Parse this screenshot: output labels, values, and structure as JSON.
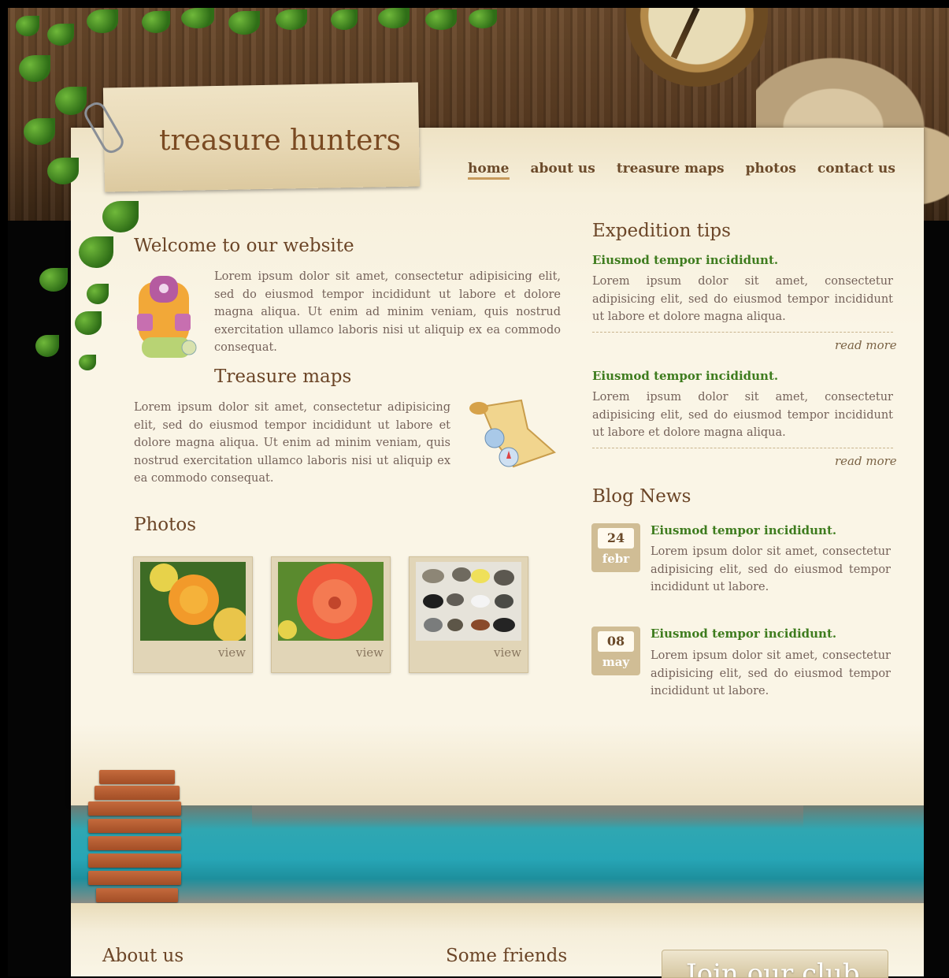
{
  "site_title": "treasure hunters",
  "nav": {
    "items": [
      "home",
      "about us",
      "treasure maps",
      "photos",
      "contact us"
    ],
    "active": "home"
  },
  "welcome": {
    "title": "Welcome to our website",
    "text": "Lorem ipsum dolor sit amet, consectetur adipisicing elit, sed do eiusmod tempor incididunt ut labore et dolore magna aliqua. Ut enim ad minim veniam, quis nostrud exercitation ullamco laboris nisi ut aliquip ex ea commodo consequat."
  },
  "treasure_maps": {
    "title": "Treasure maps",
    "text": "Lorem ipsum dolor sit amet, consectetur adipisicing elit, sed do eiusmod tempor incididunt ut labore et dolore magna aliqua. Ut enim ad minim veniam, quis nostrud exercitation ullamco laboris nisi ut aliquip ex ea commodo consequat."
  },
  "photos": {
    "title": "Photos",
    "items": [
      {
        "view_label": "view",
        "subject": "orange-flower"
      },
      {
        "view_label": "view",
        "subject": "red-flower"
      },
      {
        "view_label": "view",
        "subject": "rock-samples"
      }
    ]
  },
  "expedition": {
    "title": "Expedition tips",
    "items": [
      {
        "heading": "Eiusmod tempor incididunt.",
        "text": "Lorem ipsum dolor sit amet, consectetur adipisicing elit, sed do eiusmod tempor incididunt ut labore et dolore magna aliqua.",
        "read_more": "read more"
      },
      {
        "heading": "Eiusmod tempor incididunt.",
        "text": "Lorem ipsum dolor sit amet, consectetur adipisicing elit, sed do eiusmod tempor incididunt ut labore et dolore magna aliqua.",
        "read_more": "read more"
      }
    ]
  },
  "blog": {
    "title": "Blog News",
    "items": [
      {
        "day": "24",
        "month": "febr",
        "heading": "Eiusmod tempor incididunt.",
        "text": "Lorem ipsum dolor sit amet, consectetur adipisicing elit, sed do eiusmod tempor incididunt ut labore."
      },
      {
        "day": "08",
        "month": "may",
        "heading": "Eiusmod tempor incididunt.",
        "text": "Lorem ipsum dolor sit amet, consectetur adipisicing elit, sed do eiusmod tempor incididunt ut labore."
      }
    ]
  },
  "footer": {
    "about_title": "About us",
    "friends_title": "Some friends",
    "join_label": "Join our club"
  },
  "colors": {
    "heading_brown": "#6b4527",
    "link_green": "#3e7c1e",
    "paper": "#faf5e6",
    "badge": "#d0bd95"
  }
}
